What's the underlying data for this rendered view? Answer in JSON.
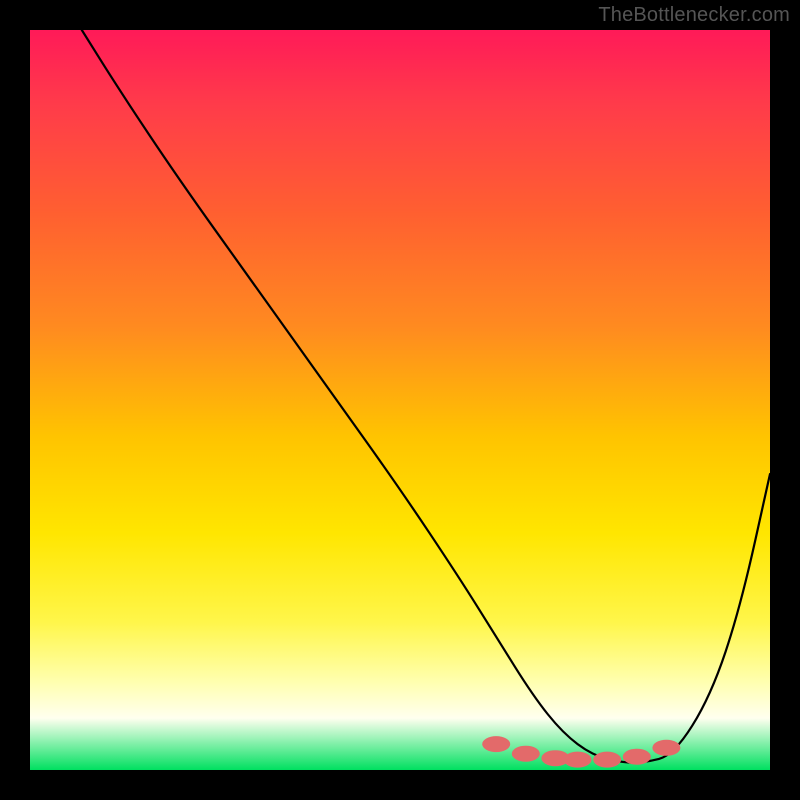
{
  "watermark": "TheBottlenecker.com",
  "chart_data": {
    "type": "line",
    "title": "",
    "xlabel": "",
    "ylabel": "",
    "xlim": [
      0,
      100
    ],
    "ylim": [
      0,
      100
    ],
    "grid": false,
    "series": [
      {
        "name": "curve",
        "x": [
          7,
          12,
          20,
          30,
          40,
          50,
          58,
          63,
          68,
          72,
          76,
          80,
          83,
          87,
          92,
          96,
          100
        ],
        "y": [
          100,
          92,
          80,
          66,
          52,
          38,
          26,
          18,
          10,
          5,
          2,
          1,
          1,
          2,
          10,
          22,
          40
        ]
      }
    ],
    "markers": {
      "color": "#e36a6a",
      "points": [
        {
          "x": 63,
          "y": 3.5
        },
        {
          "x": 67,
          "y": 2.2
        },
        {
          "x": 71,
          "y": 1.6
        },
        {
          "x": 74,
          "y": 1.4
        },
        {
          "x": 78,
          "y": 1.4
        },
        {
          "x": 82,
          "y": 1.8
        },
        {
          "x": 86,
          "y": 3.0
        }
      ]
    },
    "gradient_stops": [
      {
        "pos": 0.0,
        "color": "#ff1a58"
      },
      {
        "pos": 0.25,
        "color": "#ff6030"
      },
      {
        "pos": 0.55,
        "color": "#ffc400"
      },
      {
        "pos": 0.8,
        "color": "#fff64a"
      },
      {
        "pos": 1.0,
        "color": "#00e060"
      }
    ]
  }
}
